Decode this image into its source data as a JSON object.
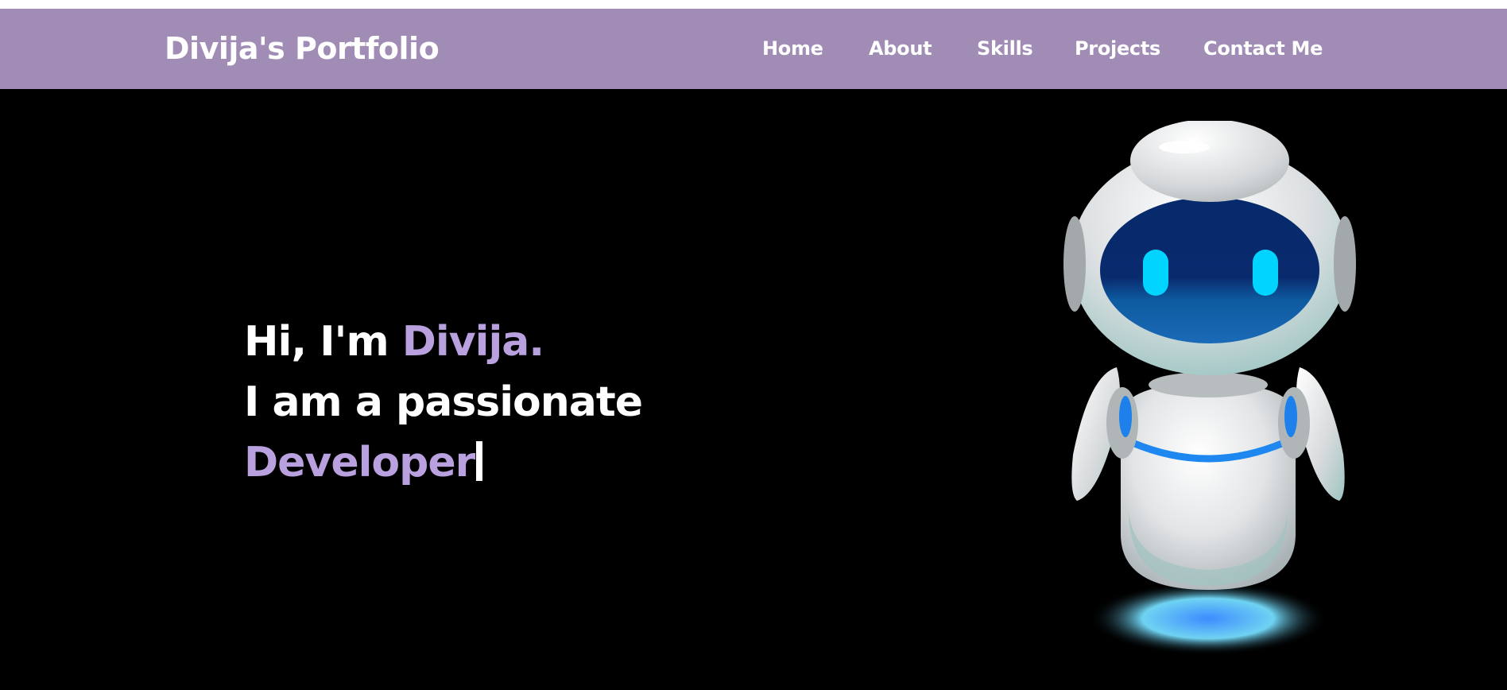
{
  "brand": {
    "title": "Divija's Portfolio"
  },
  "nav": {
    "items": [
      {
        "label": "Home"
      },
      {
        "label": "About"
      },
      {
        "label": "Skills"
      },
      {
        "label": "Projects"
      },
      {
        "label": "Contact Me"
      }
    ]
  },
  "hero": {
    "greeting_prefix": "Hi, I'm ",
    "name": "Divija.",
    "line2": "I am a passionate",
    "typed_role": "Developer"
  },
  "colors": {
    "navbar_bg": "#a18cb6",
    "accent": "#b9a0df",
    "page_bg": "#000000",
    "text": "#ffffff"
  },
  "icons": {
    "hero_image": "robot-illustration"
  }
}
